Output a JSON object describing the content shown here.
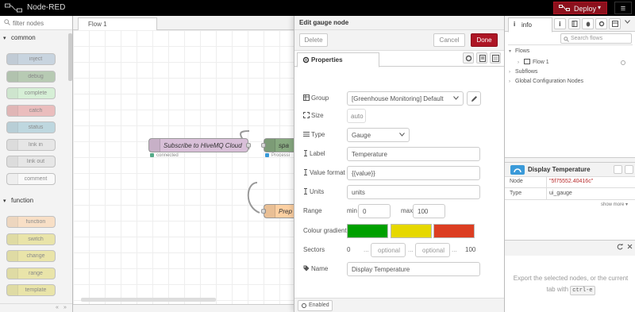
{
  "app": {
    "title": "Node-RED"
  },
  "header": {
    "deploy_label": "Deploy"
  },
  "palette": {
    "filter_placeholder": "filter nodes",
    "categories": [
      {
        "name": "common",
        "nodes": [
          {
            "label": "inject",
            "color": "#a6bbcf"
          },
          {
            "label": "debug",
            "color": "#87a980"
          },
          {
            "label": "complete",
            "color": "#c0edc0"
          },
          {
            "label": "catch",
            "color": "#e49191"
          },
          {
            "label": "status",
            "color": "#94c1d0"
          },
          {
            "label": "link in",
            "color": "#dddddd"
          },
          {
            "label": "link out",
            "color": "#dddddd"
          },
          {
            "label": "comment",
            "color": "#ffffff"
          }
        ]
      },
      {
        "name": "function",
        "nodes": [
          {
            "label": "function",
            "color": "#fdd0a2"
          },
          {
            "label": "switch",
            "color": "#e2d96e"
          },
          {
            "label": "change",
            "color": "#e2d96e"
          },
          {
            "label": "range",
            "color": "#e2d96e"
          },
          {
            "label": "template",
            "color": "#e2d96e"
          }
        ]
      }
    ]
  },
  "workspace": {
    "tab_label": "Flow 1",
    "nodes": [
      {
        "label": "Subscribe to HiveMQ Cloud",
        "color": "#d8bfd8",
        "status": "connected",
        "status_color": "#5a8"
      },
      {
        "label": "spa",
        "color": "#87a980",
        "status": "Processi",
        "status_color": "#3a9ad9"
      },
      {
        "label": "Prep",
        "color": "#fdd0a2"
      }
    ]
  },
  "tray": {
    "title": "Edit gauge node",
    "delete_label": "Delete",
    "cancel_label": "Cancel",
    "done_label": "Done",
    "tab_properties": "Properties",
    "fields": {
      "group_label": "Group",
      "group_value": "[Greenhouse Monitoring] Default",
      "size_label": "Size",
      "size_value": "auto",
      "type_label": "Type",
      "type_value": "Gauge",
      "label_label": "Label",
      "label_value": "Temperature",
      "format_label": "Value format",
      "format_value": "{{value}}",
      "units_label": "Units",
      "units_value": "units",
      "range_label": "Range",
      "min_label": "min",
      "min_value": "0",
      "max_label": "max",
      "max_value": "100",
      "gradient_label": "Colour gradient",
      "gradient_colors": [
        "#00a000",
        "#e6d800",
        "#dc3e22"
      ],
      "sectors_label": "Sectors",
      "sectors_start": "0",
      "sectors_dots1": "...",
      "sectors_ph1": "optional",
      "sectors_dots2": "...",
      "sectors_ph2": "optional",
      "sectors_dots3": "...",
      "sectors_end": "100",
      "name_label": "Name",
      "name_value": "Display Temperature"
    },
    "enabled_label": "Enabled"
  },
  "sidebar": {
    "tab_label": "info",
    "search_placeholder": "Search flows",
    "tree": {
      "flows": "Flows",
      "flow1": "Flow 1",
      "subflows": "Subflows",
      "global": "Global Configuration Nodes"
    },
    "node_title": "Display Temperature",
    "props": [
      {
        "key": "Node",
        "value": "\"5f75552.40416c\"",
        "is_string": true
      },
      {
        "key": "Type",
        "value": "ui_gauge",
        "is_string": false
      }
    ],
    "show_more": "show more ▾",
    "help_text_1": "Export the selected nodes, or the current tab with",
    "help_kbd": "ctrl-e"
  }
}
